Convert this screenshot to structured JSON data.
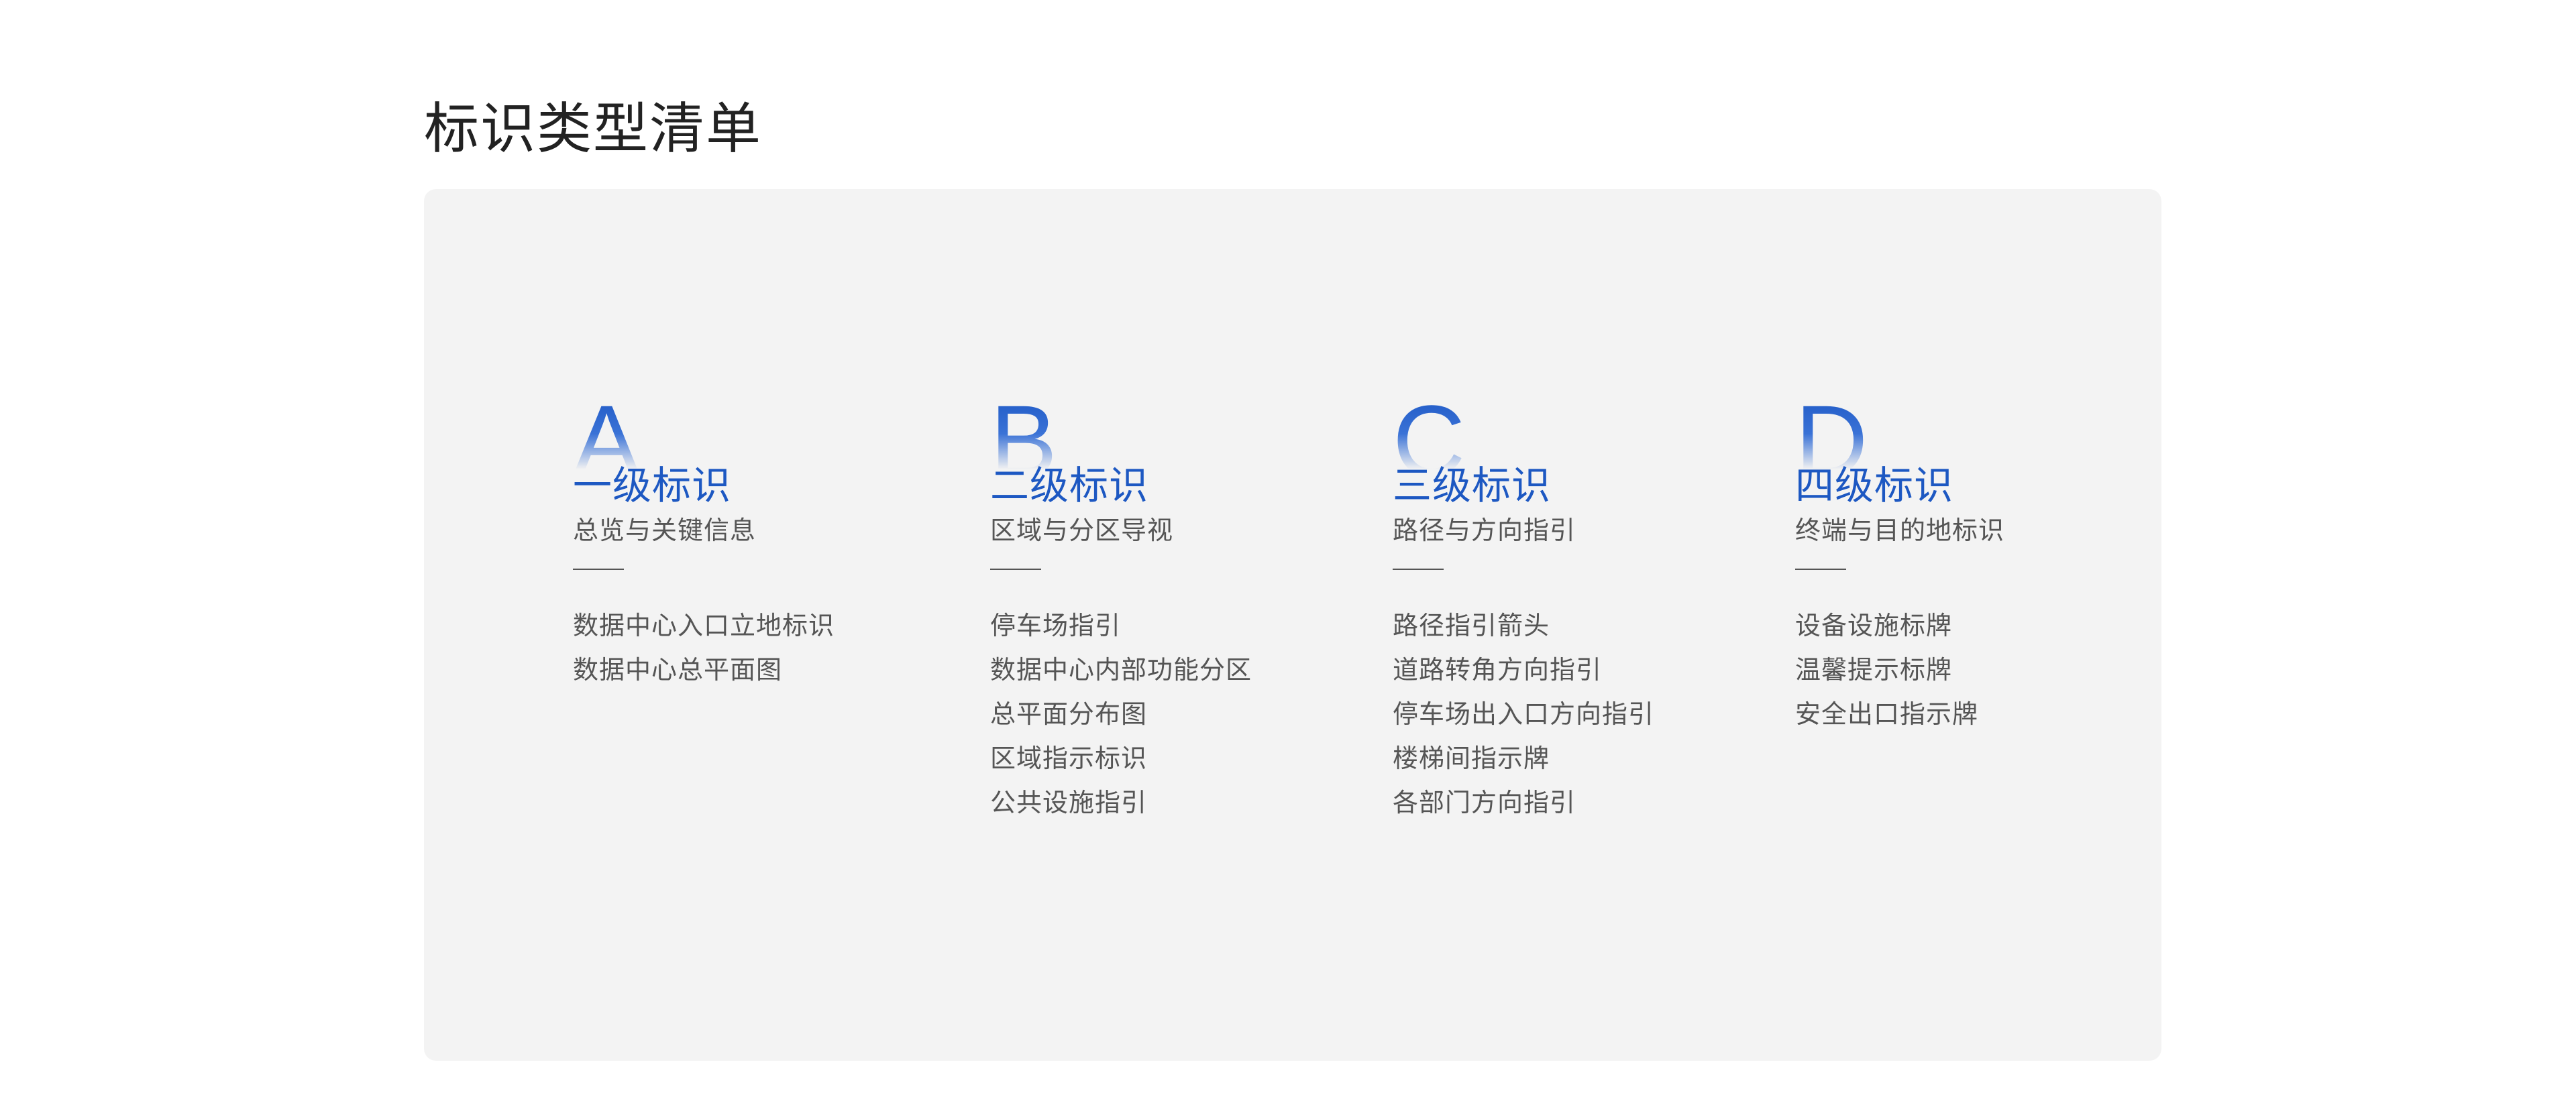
{
  "page": {
    "title": "标识类型清单"
  },
  "colors": {
    "accent": "#1d58c2",
    "panel_background": "#f3f3f3",
    "text_secondary": "#555555"
  },
  "categories": [
    {
      "letter": "A",
      "title": "一级标识",
      "subtitle": "总览与关键信息",
      "items": [
        "数据中心入口立地标识",
        "数据中心总平面图"
      ]
    },
    {
      "letter": "B",
      "title": "二级标识",
      "subtitle": "区域与分区导视",
      "items": [
        "停车场指引",
        "数据中心内部功能分区",
        "总平面分布图",
        "区域指示标识",
        "公共设施指引"
      ]
    },
    {
      "letter": "C",
      "title": "三级标识",
      "subtitle": "路径与方向指引",
      "items": [
        "路径指引箭头",
        "道路转角方向指引",
        "停车场出入口方向指引",
        "楼梯间指示牌",
        "各部门方向指引"
      ]
    },
    {
      "letter": "D",
      "title": "四级标识",
      "subtitle": "终端与目的地标识",
      "items": [
        "设备设施标牌",
        "温馨提示标牌",
        "安全出口指示牌"
      ]
    }
  ]
}
